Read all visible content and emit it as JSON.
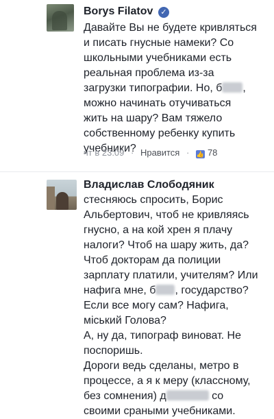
{
  "comments": [
    {
      "author": "Borys Filatov",
      "verified": true,
      "lines": [
        "Давайте Вы не будете кривляться",
        "и писать гнусные намеки? Со",
        "школьными учебниками есть",
        "реальная проблема из-за",
        "загрузки типографии. Но, б",
        "можно начинать отучиваться",
        "жить на шару? Вам тяжело",
        "собственному ребенку купить",
        "учебники?"
      ],
      "line5_after_blur": ", ",
      "time": "чт в 23:09",
      "like_label": "Нравится",
      "like_count": "78"
    },
    {
      "author": "Владислав Слободяник",
      "lines": [
        "стесняюсь спросить, Борис",
        "Альбертович, чтоб не кривляясь",
        "гнусно, а на кой хрен я плачу",
        "налоги? Чтоб на шару жить, да?",
        "Чтоб докторам да полиции",
        "зарплату платили, учителям? Или",
        "нафига мне, б",
        "Если  все могу сам? Нафига,",
        "міський Голова?",
        "А, ну да, типограф виноват. Не",
        "поспоришь.",
        "Дороги ведь сделаны, метро в",
        "процессе, а я к меру (классному,",
        "без сомнения) д",
        "своими сраными учебниками."
      ],
      "line7_after_blur": ", государство?",
      "line14_after_blur": " со"
    }
  ],
  "colors": {
    "text": "#1d2129",
    "meta": "#90949c",
    "verified": "#4267b2",
    "like_icon": "#5b7bd5"
  }
}
